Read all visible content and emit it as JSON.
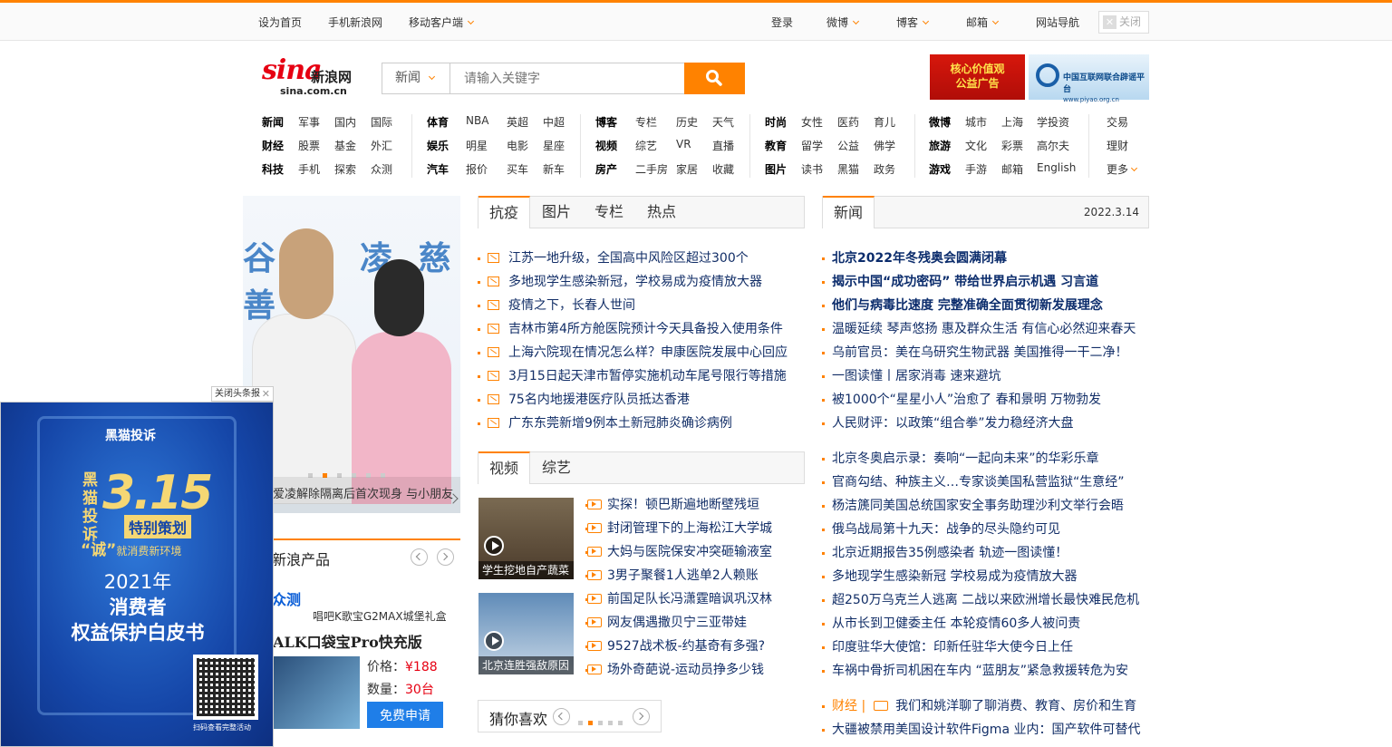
{
  "topbar": {
    "set_home": "设为首页",
    "mobile_sina": "手机新浪网",
    "mobile_client": "移动客户端",
    "login": "登录",
    "weibo": "微博",
    "blog": "博客",
    "mail": "邮箱",
    "site_nav": "网站导航",
    "close": "关闭"
  },
  "header": {
    "logo_main": "sina",
    "logo_cn": "新浪网",
    "logo_domain": "sina.com.cn",
    "search_category": "新闻",
    "search_placeholder": "请输入关键字",
    "ad1_line1": "核心价值观",
    "ad1_line2": "公益广告",
    "ad2_text": "中国互联网联合辟谣平台",
    "ad2_sub": "www.piyao.org.cn"
  },
  "nav": {
    "col1": [
      [
        "新闻",
        "军事",
        "国内",
        "国际"
      ],
      [
        "财经",
        "股票",
        "基金",
        "外汇"
      ],
      [
        "科技",
        "手机",
        "探索",
        "众测"
      ]
    ],
    "col2": [
      [
        "体育",
        "NBA",
        "英超",
        "中超"
      ],
      [
        "娱乐",
        "明星",
        "电影",
        "星座"
      ],
      [
        "汽车",
        "报价",
        "买车",
        "新车"
      ]
    ],
    "col3": [
      [
        "博客",
        "专栏",
        "历史",
        "天气"
      ],
      [
        "视频",
        "综艺",
        "VR",
        "直播"
      ],
      [
        "房产",
        "二手房",
        "家居",
        "收藏"
      ]
    ],
    "col4": [
      [
        "时尚",
        "女性",
        "医药",
        "育儿"
      ],
      [
        "教育",
        "留学",
        "公益",
        "佛学"
      ],
      [
        "图片",
        "读书",
        "黑猫",
        "政务"
      ]
    ],
    "col5": [
      [
        "微博",
        "城市",
        "上海",
        "学投资"
      ],
      [
        "旅游",
        "文化",
        "彩票",
        "高尔夫"
      ],
      [
        "游戏",
        "手游",
        "邮箱",
        "English"
      ]
    ],
    "col6": [
      "交易",
      "理财",
      "更多"
    ]
  },
  "carousel": {
    "wall_text": "谷 爱 凌 慈 善",
    "caption": "谷爱凌解除隔离后首次现身 与小朋友"
  },
  "news_tabs": [
    "抗疫",
    "图片",
    "专栏",
    "热点"
  ],
  "epidemic_news": [
    "江苏一地升级，全国高中风险区超过300个",
    "多地现学生感染新冠，学校易成为疫情放大器",
    "疫情之下，长春人世间",
    "吉林市第4所方舱医院预计今天具备投入使用条件",
    "上海六院现在情况怎么样？申康医院发展中心回应",
    "3月15日起天津市暂停实施机动车尾号限行等措施",
    "75名内地援港医疗队员抵达香港",
    "广东东莞新增9例本土新冠肺炎确诊病例"
  ],
  "video_tabs": [
    "视频",
    "综艺"
  ],
  "video_thumbs": [
    "学生挖地自产蔬菜",
    "北京连胜强敌原因"
  ],
  "video_news": [
    "实探！顿巴斯遍地断壁残垣",
    "封闭管理下的上海松江大学城",
    "大妈与医院保安冲突砸输液室",
    "3男子聚餐1人逃单2人赖账",
    "前国足队长冯潇霆暗讽巩汉林",
    "网友偶遇撒贝宁三亚带娃",
    "9527战术板-约基奇有多强?",
    "场外奇葩说-运动员挣多少钱"
  ],
  "right_panel": {
    "tab": "新闻",
    "date": "2022.3.14",
    "headlines": [
      "北京2022年冬残奥会圆满闭幕",
      "揭示中国“成功密码” 带给世界启示机遇 习言道",
      "他们与病毒比速度 完整准确全面贯彻新发展理念"
    ],
    "news_a": [
      "温暖延续 琴声悠扬 惠及群众生活 有信心必然迎来春天",
      "乌前官员：美在乌研究生物武器 美国推得一干二净！",
      "一图读懂丨居家消毒 速来避坑",
      "被1000个“星星小人”治愈了 春和景明 万物勃发",
      "人民财评：以政策“组合拳”发力稳经济大盘"
    ],
    "news_b": [
      "北京冬奥启示录：奏响“一起向未来”的华彩乐章",
      "官商勾结、种族主义…专家谈美国私营监狱“生意经”",
      "杨洁篪同美国总统国家安全事务助理沙利文举行会晤",
      "俄乌战局第十九天：战争的尽头隐约可见",
      "北京近期报告35例感染者 轨迹一图读懂！",
      "多地现学生感染新冠 学校易成为疫情放大器",
      "超250万乌克兰人逃离 二战以来欧洲增长最快难民危机",
      "从市长到卫健委主任 本轮疫情60多人被问责",
      "印度驻华大使馆：印新任驻华大使今日上任",
      "车祸中骨折司机困在车内 “蓝朋友”紧急救援转危为安"
    ],
    "finance_label": "财经 |",
    "finance_news": "我们和姚洋聊了聊消费、教育、房价和生育",
    "last_news": "大疆被禁用美国设计软件Figma 业内：国产软件可替代"
  },
  "products": {
    "title": "新浪产品",
    "subtitle": "新浪众测",
    "promo": "唱吧K歌宝G2MAX城堡礼盒",
    "product_name": "TALK口袋宝Pro快充版",
    "price_label": "价格：",
    "price_value": "¥188",
    "qty_label": "数量：",
    "qty_value": "30台",
    "apply_button": "免费申请"
  },
  "overlay_ad": {
    "close_text": "关闭头条报",
    "brand": "黑猫投诉",
    "vertical_text": "黑猫投诉",
    "big_number": "3.15",
    "tag": "特别策划",
    "slogan_quote": "“诚”",
    "slogan_rest": "就消费新环境",
    "year_line": "2021年",
    "line2": "消费者",
    "line3": "权益保护白皮书",
    "qr_caption": "扫码查看完整活动"
  },
  "guess": {
    "title": "猜你喜欢"
  },
  "colors": {
    "accent": "#ff8200",
    "link": "#122e67",
    "ad_blue": "#1546a8"
  }
}
